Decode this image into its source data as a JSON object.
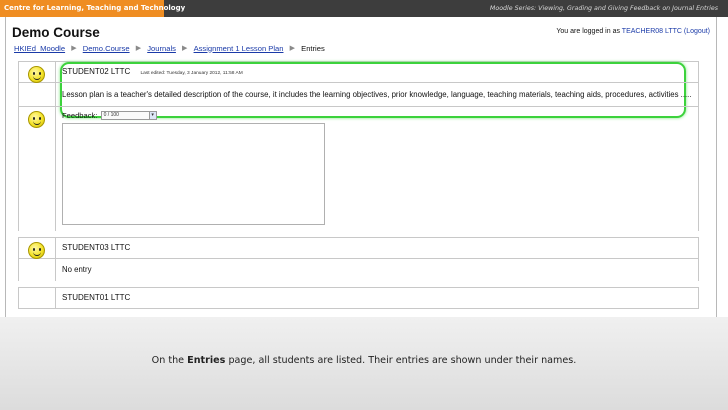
{
  "header": {
    "left_text": "Centre for Learning, Teaching and Technology",
    "right_text": "Moodle Series: Viewing, Grading and Giving Feedback on Journal Entries"
  },
  "page": {
    "course_title": "Demo Course",
    "logged_in_prefix": "You are logged in as",
    "logged_in_user": "TEACHER08 LTTC",
    "logout_label": "(Logout)"
  },
  "breadcrumb": {
    "items": [
      "HKIEd_Moodle",
      "Demo.Course",
      "Journals",
      "Assignment 1 Lesson Plan"
    ],
    "current": "Entries",
    "separator": "▶"
  },
  "entries": [
    {
      "name": "STUDENT02 LTTC",
      "last_edited": "Last edited: Tuesday, 3 January 2012, 11:58 AM",
      "text": "Lesson plan is a teacher's detailed description of the course, it includes the learning objectives, prior knowledge, language, teaching materials, teaching aids, procedures, activities .....",
      "feedback_label": "Feedback:",
      "grade_value": "0 / 100"
    },
    {
      "name": "STUDENT03 LTTC",
      "text": "No entry"
    },
    {
      "name": "STUDENT01 LTTC"
    }
  ],
  "caption": {
    "prefix": "On the",
    "bold": "Entries",
    "suffix": "page, all students are listed. Their entries are shown under their names."
  },
  "colors": {
    "accent_orange": "#ef8d22",
    "header_dark": "#3d3d3d",
    "highlight_green": "#3cd23c",
    "link_blue": "#1a3aa8"
  }
}
